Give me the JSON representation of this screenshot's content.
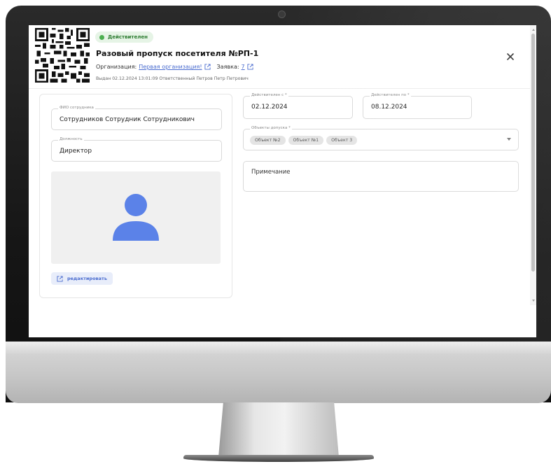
{
  "header": {
    "status": "Действителен",
    "status_color": "#4caf50",
    "title": "Разовый пропуск посетителя №РП-1",
    "org_label": "Организация:",
    "org_link": "Первая организация!",
    "request_label": "Заявка:",
    "request_link": "7",
    "issued_line": "Выдан 02.12.2024 13:01:09 Ответственный Петров Петр Петрович"
  },
  "employee": {
    "fio_label": "ФИО сотрудника",
    "fio_value": "Сотрудников Сотрудник Сотрудникович",
    "position_label": "Должность",
    "position_value": "Директор",
    "edit_label": "редактировать"
  },
  "validity": {
    "from_label": "Действителен с *",
    "from_value": "02.12.2024",
    "to_label": "Действителен по *",
    "to_value": "08.12.2024"
  },
  "access": {
    "label": "Объекты допуска *",
    "chips": [
      "Объект №2",
      "Объект №1",
      "Объект 3"
    ]
  },
  "note": {
    "placeholder": "Примечание"
  },
  "colors": {
    "accent": "#4a6ccf",
    "avatar": "#5b82e8",
    "monitor_bezel": "#1a1a1a"
  }
}
